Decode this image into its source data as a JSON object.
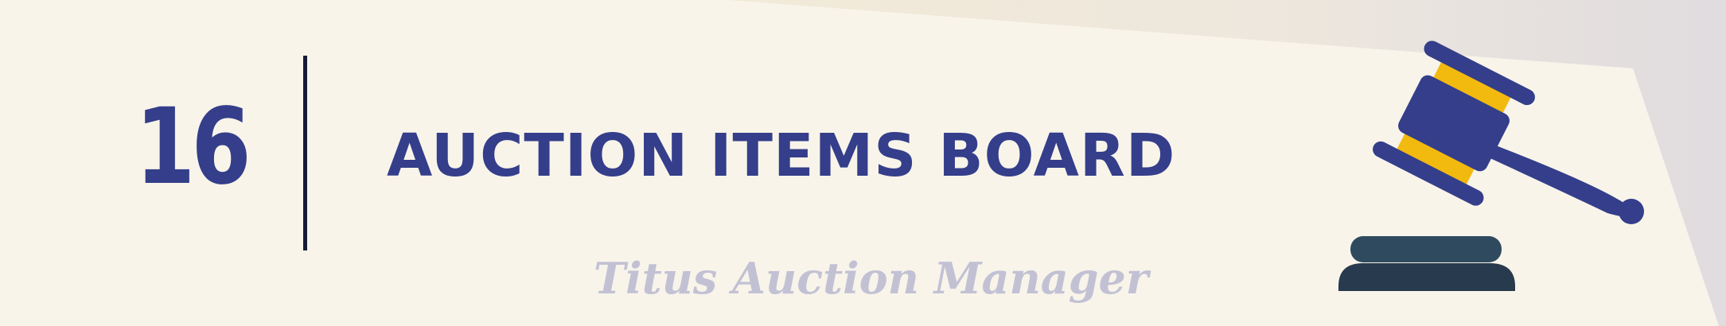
{
  "banner": {
    "number": "16",
    "title": "AUCTION ITEMS BOARD",
    "brand": "Titus Auction Manager"
  },
  "icons": {
    "gavel": "gavel-icon",
    "sound_block": "sound-block-icon"
  },
  "colors": {
    "background": "#f8f4ea",
    "accent": "#343e8a",
    "gavel_band": "#f2b90f",
    "base": "#2c3f52",
    "divider": "#161a3a",
    "brand_text": "#c2c1d4"
  }
}
